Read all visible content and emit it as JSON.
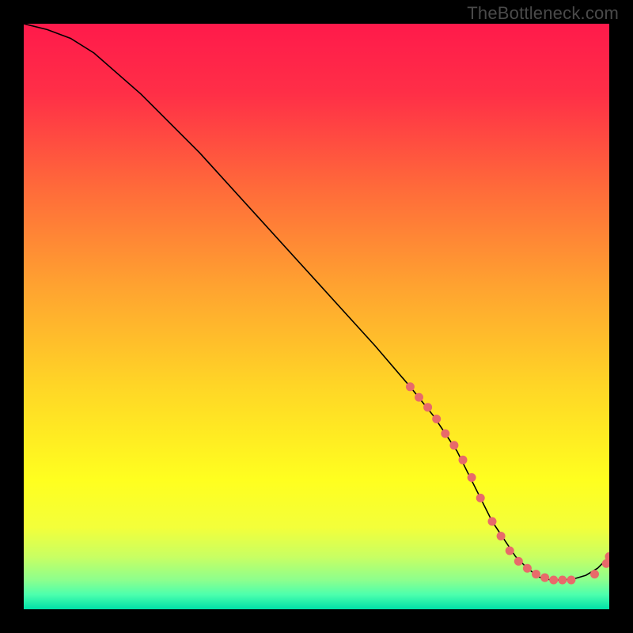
{
  "watermark": "TheBottleneck.com",
  "chart_data": {
    "type": "line",
    "title": "",
    "xlabel": "",
    "ylabel": "",
    "xlim": [
      0,
      100
    ],
    "ylim": [
      0,
      100
    ],
    "grid": false,
    "legend": false,
    "gradient_stops": [
      {
        "offset": 0.0,
        "color": "#ff1a4b"
      },
      {
        "offset": 0.12,
        "color": "#ff2f47"
      },
      {
        "offset": 0.28,
        "color": "#ff6a3a"
      },
      {
        "offset": 0.45,
        "color": "#ffa330"
      },
      {
        "offset": 0.62,
        "color": "#ffd626"
      },
      {
        "offset": 0.78,
        "color": "#ffff1f"
      },
      {
        "offset": 0.86,
        "color": "#f3ff3a"
      },
      {
        "offset": 0.91,
        "color": "#c9ff62"
      },
      {
        "offset": 0.95,
        "color": "#8dff8d"
      },
      {
        "offset": 0.975,
        "color": "#4cffad"
      },
      {
        "offset": 1.0,
        "color": "#00e0a8"
      }
    ],
    "series": [
      {
        "name": "bottleneck-curve",
        "x": [
          0,
          4,
          8,
          12,
          20,
          30,
          40,
          50,
          60,
          66,
          70,
          72,
          74,
          76,
          78,
          80,
          82,
          84,
          86,
          88,
          90,
          92,
          94,
          96,
          98,
          100
        ],
        "y": [
          100,
          99,
          97.5,
          95,
          88,
          78,
          67,
          56,
          45,
          38,
          33,
          30,
          27,
          23,
          19,
          15,
          12,
          9,
          7,
          5.5,
          5,
          5,
          5.2,
          5.8,
          7,
          9
        ],
        "stroke": "#000000",
        "stroke_width": 1.6
      }
    ],
    "points": {
      "name": "markers",
      "color": "#e86a6a",
      "radius": 5.5,
      "x": [
        66,
        67.5,
        69,
        70.5,
        72,
        73.5,
        75,
        76.5,
        78,
        80,
        81.5,
        83,
        84.5,
        86,
        87.5,
        89,
        90.5,
        92,
        93.5,
        97.5,
        99.5,
        100
      ],
      "y": [
        38,
        36.2,
        34.5,
        32.5,
        30,
        28,
        25.5,
        22.5,
        19,
        15,
        12.5,
        10,
        8.2,
        7,
        6,
        5.4,
        5,
        5,
        5,
        6,
        7.8,
        9
      ]
    }
  }
}
